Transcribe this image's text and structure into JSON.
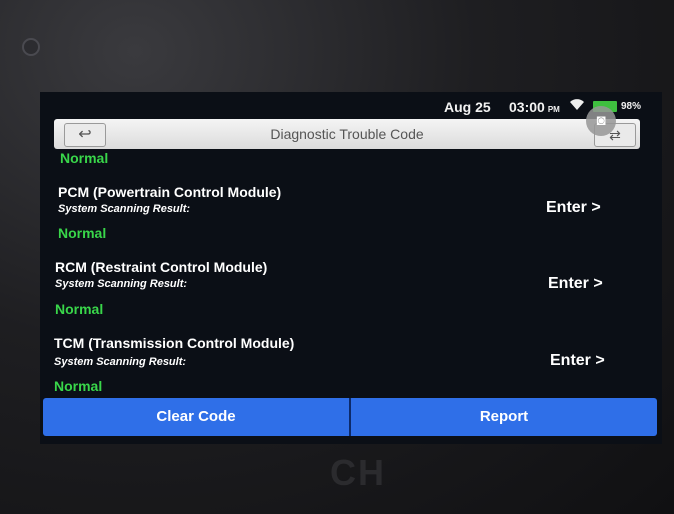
{
  "statusbar": {
    "date": "Aug 25",
    "time": "03:00",
    "ampm": "PM",
    "battery_pct": "98%",
    "wifi_icon": "wifi-icon",
    "battery_color": "#3fbf3f"
  },
  "header": {
    "title": "Diagnostic Trouble Code",
    "back_icon": "↩",
    "swap_icon": "⇄",
    "snapshot_icon": "◙"
  },
  "top_partial_status": "Normal",
  "modules": [
    {
      "name": "PCM (Powertrain Control Module)",
      "result_label": "System Scanning Result:",
      "status": "Normal",
      "action": "Enter >"
    },
    {
      "name": "RCM (Restraint Control Module)",
      "result_label": "System Scanning Result:",
      "status": "Normal",
      "action": "Enter >"
    },
    {
      "name": "TCM (Transmission Control Module)",
      "result_label": "System Scanning Result:",
      "status": "Normal",
      "action": "Enter >"
    }
  ],
  "footer": {
    "clear_label": "Clear Code",
    "report_label": "Report",
    "accent": "#2f6fe8",
    "status_color": "#39d64a"
  },
  "device": {
    "brand_fragment": "CH"
  }
}
